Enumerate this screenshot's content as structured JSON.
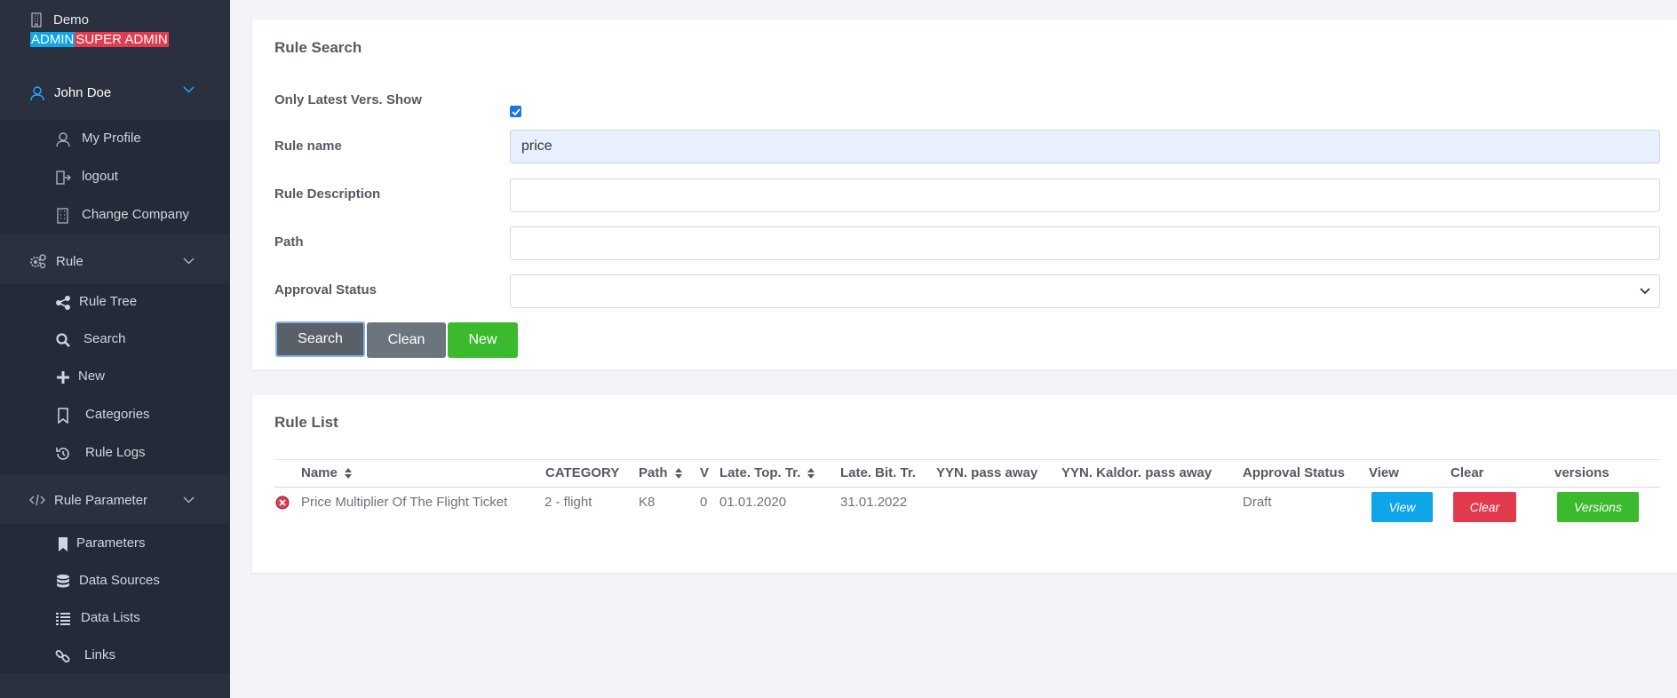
{
  "sidebar": {
    "brand": {
      "company": "Demo",
      "role_admin": "ADMIN",
      "role_super": "SUPER ADMIN"
    },
    "user": {
      "name": "John Doe",
      "items": [
        {
          "label": "My Profile",
          "icon": "user-icon"
        },
        {
          "label": "logout",
          "icon": "logout-icon"
        },
        {
          "label": "Change Company",
          "icon": "building-icon"
        }
      ]
    },
    "rule": {
      "label": "Rule",
      "items": [
        {
          "label": "Rule Tree",
          "icon": "share-icon"
        },
        {
          "label": "Search",
          "icon": "search-icon"
        },
        {
          "label": "New",
          "icon": "plus-icon"
        },
        {
          "label": "Categories",
          "icon": "bookmark-icon"
        },
        {
          "label": "Rule Logs",
          "icon": "history-icon"
        }
      ]
    },
    "rule_parameter": {
      "label": "Rule Parameter",
      "items": [
        {
          "label": "Parameters",
          "icon": "bookmark-filled-icon"
        },
        {
          "label": "Data Sources",
          "icon": "database-icon"
        },
        {
          "label": "Data Lists",
          "icon": "list-icon"
        },
        {
          "label": "Links",
          "icon": "link-icon"
        }
      ]
    }
  },
  "search": {
    "title": "Rule Search",
    "latest_label": "Only Latest Vers. Show",
    "latest_checked": true,
    "rule_name_label": "Rule name",
    "rule_name_value": "price",
    "rule_desc_label": "Rule Description",
    "rule_desc_value": "",
    "path_label": "Path",
    "path_value": "",
    "approval_label": "Approval Status",
    "approval_value": "",
    "buttons": {
      "search": "Search",
      "clean": "Clean",
      "new": "New"
    }
  },
  "list": {
    "title": "Rule List",
    "headers": [
      "Name",
      "CATEGORY",
      "Path",
      "V",
      "Late. Top. Tr.",
      "Late. Bit. Tr.",
      "YYN. pass away",
      "YYN. Kaldor. pass away",
      "Approval Status",
      "View",
      "Clear",
      "versions"
    ],
    "rows": [
      {
        "name": "Price Multiplier Of The Flight Ticket",
        "category": "2 - flight",
        "path": "K8",
        "v": "0",
        "top": "01.01.2020",
        "bit": "31.01.2022",
        "yyn": "",
        "kaldor": "",
        "status": "Draft",
        "view": "View",
        "clear": "Clear",
        "versions": "Versions"
      }
    ]
  },
  "colors": {
    "sidebar": "#2b303f",
    "sidebar_sub": "#242a37",
    "accent": "#1a73e8",
    "view": "#0ea5e9",
    "clear": "#e23b4e",
    "green": "#3cba2e"
  }
}
